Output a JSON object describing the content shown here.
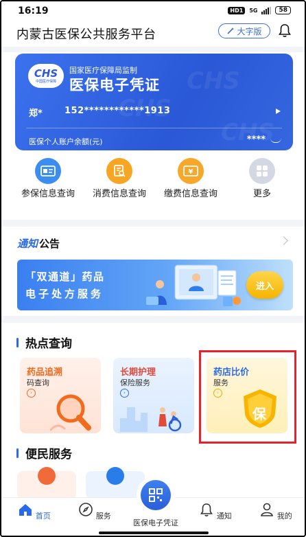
{
  "status": {
    "time": "16:19",
    "hd": "HD1",
    "net": "5G",
    "battery": "58"
  },
  "header": {
    "title": "内蒙古医保公共服务平台",
    "bigfont_label": "大字版"
  },
  "card": {
    "logo_text": "CHS",
    "logo_sub": "中国医疗保障",
    "supervise": "国家医疗保障局监制",
    "title": "医保电子凭证",
    "name": "郑*",
    "id_number": "152************1913",
    "balance_label": "医保个人账户余额(元)",
    "balance_value": "****"
  },
  "quick": [
    {
      "label": "参保信息查询",
      "icon": "id-card-icon"
    },
    {
      "label": "消费信息查询",
      "icon": "receipt-search-icon"
    },
    {
      "label": "缴费信息查询",
      "icon": "yuan-bill-icon"
    },
    {
      "label": "更多",
      "icon": "grid-more-icon"
    }
  ],
  "notice": {
    "title_a": "通知",
    "title_b": "公告"
  },
  "banner": {
    "line1": "「双通道」药品",
    "line2": "电子处方服务",
    "enter": "进入"
  },
  "hot": {
    "title": "热点查询",
    "cards": [
      {
        "title": "药品追溯",
        "sub": "码查询",
        "color": "#f26a1b"
      },
      {
        "title": "长期护理",
        "sub": "保险服务",
        "color": "#e24a3a"
      },
      {
        "title": "药店比价",
        "sub": "服务",
        "color": "#2a6ae6",
        "badge": "保"
      }
    ]
  },
  "convenience": {
    "title": "便民服务"
  },
  "tabbar": {
    "items": [
      {
        "label": "首页"
      },
      {
        "label": "服务"
      },
      {
        "label": "医保电子凭证"
      },
      {
        "label": "通知"
      },
      {
        "label": "我的"
      }
    ]
  },
  "colors": {
    "primary": "#2a6ae6",
    "highlight": "#e8222b"
  }
}
